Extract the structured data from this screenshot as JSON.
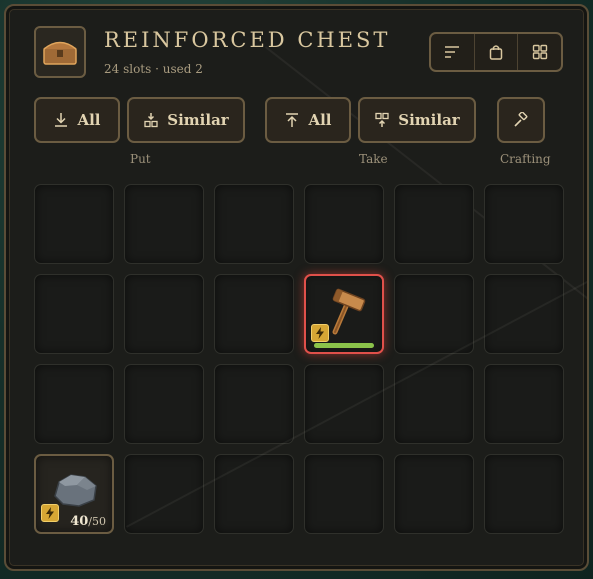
{
  "header": {
    "title": "REINFORCED CHEST",
    "subtitle": "24 slots · used 2",
    "chest_icon": "chest-icon",
    "toolbar": [
      "sort-icon",
      "bag-icon",
      "grid-view-icon"
    ]
  },
  "actions": {
    "put_all": "All",
    "put_similar": "Similar",
    "take_all": "All",
    "take_similar": "Similar",
    "put_label": "Put",
    "take_label": "Take",
    "crafting_label": "Crafting"
  },
  "inventory": {
    "total_slots": 24,
    "slots": [
      {
        "index": 9,
        "item": "hammer-icon",
        "badge": "lightning-icon",
        "durability": 1.0,
        "selected": true
      },
      {
        "index": 18,
        "item": "stone-icon",
        "badge": "lightning-icon",
        "count": "40",
        "max": "50"
      }
    ]
  },
  "colors": {
    "accent_gold": "#d9c79f",
    "border_brown": "#6b5c42",
    "selection_red": "#e0504a",
    "durability_green": "#8bc34a",
    "badge_yellow": "#d6a634"
  }
}
